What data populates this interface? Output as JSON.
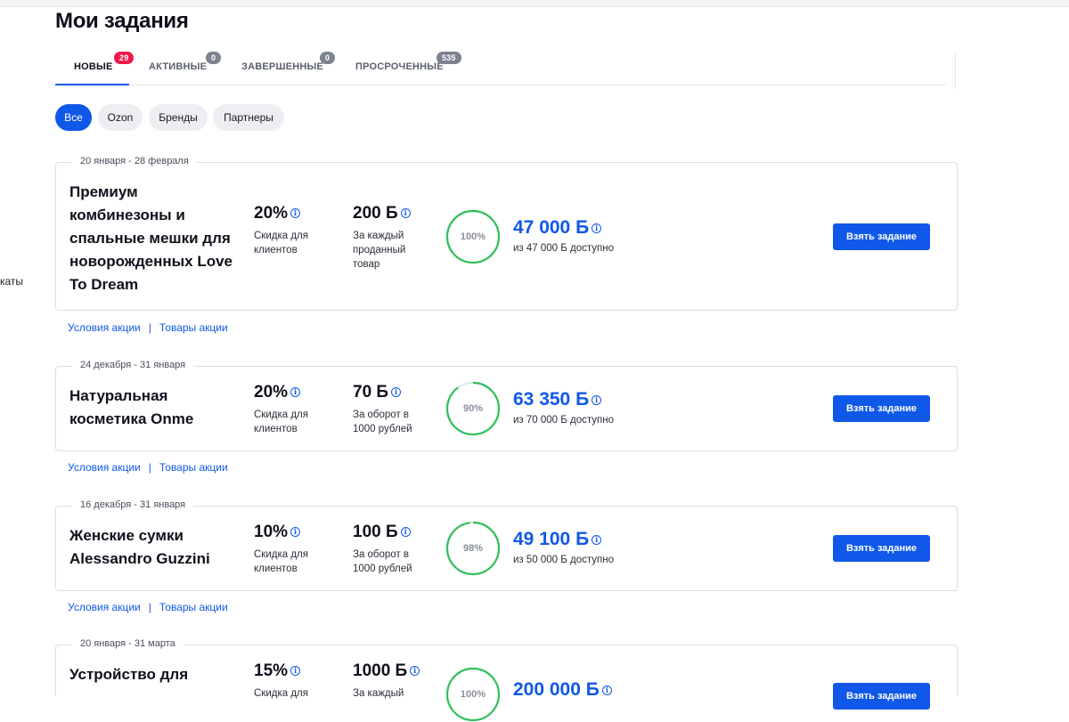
{
  "left_cut_text": "каты",
  "page": {
    "title": "Мои задания"
  },
  "tabs": [
    {
      "label": "НОВЫЕ",
      "badge": "29"
    },
    {
      "label": "АКТИВНЫЕ",
      "badge": "0"
    },
    {
      "label": "ЗАВЕРШЕННЫЕ",
      "badge": "0"
    },
    {
      "label": "ПРОСРОЧЕННЫЕ",
      "badge": "535"
    }
  ],
  "filters": [
    "Все",
    "Ozon",
    "Бренды",
    "Партнеры"
  ],
  "cards": [
    {
      "date": "20 января - 28 февраля",
      "title": "Премиум комбинезоны и спальные мешки для новорожденных Love To Dream",
      "discount": "20%",
      "discount_caption": "Скидка для клиентов",
      "reward": "200 Б",
      "reward_caption": "За каждый проданный товар",
      "progress": 1.0,
      "progress_label": "100%",
      "points": "47 000 Б",
      "points_caption": "из 47 000 Б доступно",
      "button": "Взять задание",
      "link_terms": "Условия акции",
      "link_products": "Товары акции"
    },
    {
      "date": "24 декабря - 31 января",
      "title": "Натуральная косметика Onme",
      "discount": "20%",
      "discount_caption": "Скидка для клиентов",
      "reward": "70 Б",
      "reward_caption": "За оборот в 1000 рублей",
      "progress": 0.9,
      "progress_label": "90%",
      "points": "63 350 Б",
      "points_caption": "из 70 000 Б доступно",
      "button": "Взять задание",
      "link_terms": "Условия акции",
      "link_products": "Товары акции"
    },
    {
      "date": "16 декабря - 31 января",
      "title": "Женские сумки Alessandro Guzzini",
      "discount": "10%",
      "discount_caption": "Скидка для клиентов",
      "reward": "100 Б",
      "reward_caption": "За оборот в 1000 рублей",
      "progress": 0.98,
      "progress_label": "98%",
      "points": "49 100 Б",
      "points_caption": "из 50 000 Б доступно",
      "button": "Взять задание",
      "link_terms": "Условия акции",
      "link_products": "Товары акции"
    },
    {
      "date": "20 января - 31 марта",
      "title": "Устройство для",
      "discount": "15%",
      "discount_caption": "Скидка для",
      "reward": "1000 Б",
      "reward_caption": "За каждый",
      "progress_label": "100%",
      "points": "200 000 Б",
      "button": "Взять задание"
    }
  ],
  "colors": {
    "accent": "#1058e8",
    "badge_new": "#f1174a",
    "badge_other": "#7d8290",
    "ring": "#2fbf5a",
    "ring_track": "#e3e5ea"
  }
}
